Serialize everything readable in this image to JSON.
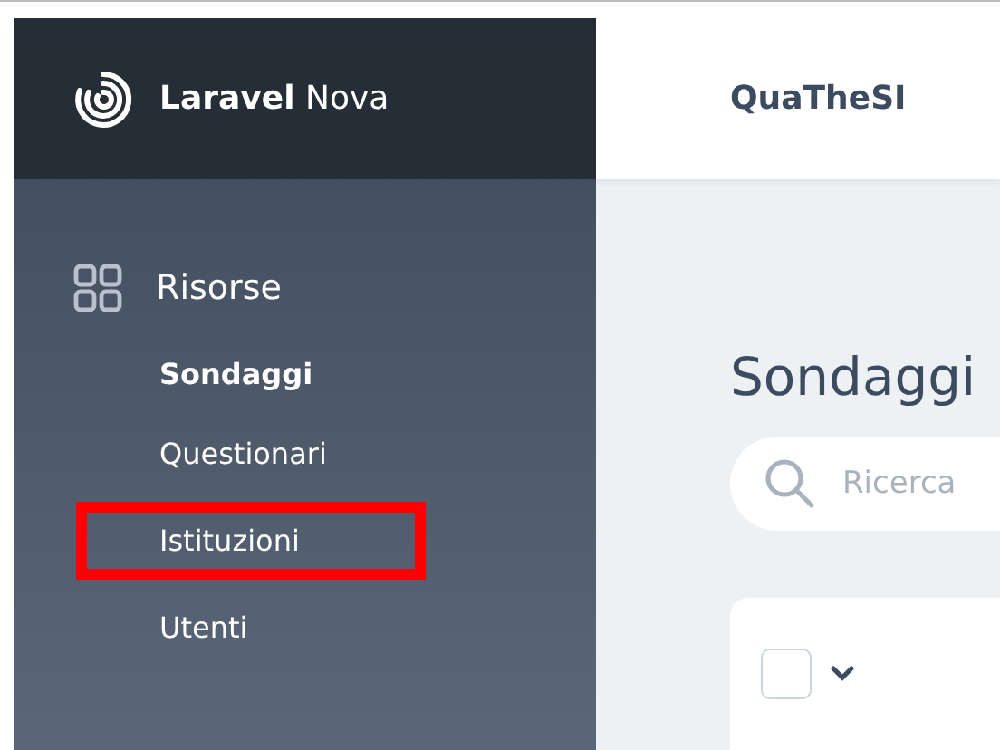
{
  "brand": {
    "name": "**Laravel** Nova"
  },
  "header": {
    "title": "QuaTheSI"
  },
  "sidebar": {
    "section": "Risorse",
    "items": [
      {
        "label": "Sondaggi",
        "selected": true,
        "highlighted": false
      },
      {
        "label": "Questionari",
        "selected": false,
        "highlighted": false
      },
      {
        "label": "Istituzioni",
        "selected": false,
        "highlighted": true
      },
      {
        "label": "Utenti",
        "selected": false,
        "highlighted": false
      }
    ]
  },
  "page": {
    "title": "Sondaggi",
    "search": {
      "placeholder": "Ricerca"
    },
    "select_all": {
      "checked": false
    }
  }
}
